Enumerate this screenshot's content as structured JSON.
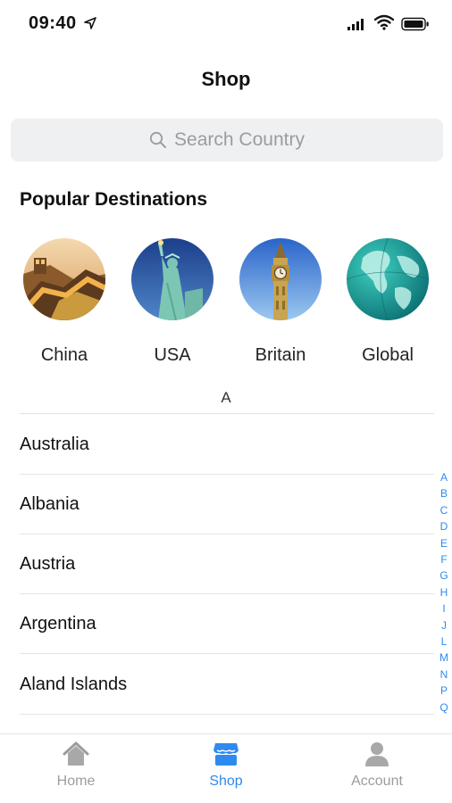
{
  "status_bar": {
    "time": "09:40"
  },
  "header": {
    "title": "Shop"
  },
  "search": {
    "placeholder": "Search Country"
  },
  "popular": {
    "title": "Popular Destinations",
    "items": [
      {
        "label": "China",
        "image": "great-wall"
      },
      {
        "label": "USA",
        "image": "statue-of-liberty"
      },
      {
        "label": "Britain",
        "image": "big-ben"
      },
      {
        "label": "Global",
        "image": "globe"
      }
    ]
  },
  "list": {
    "section_letter": "A",
    "countries": [
      "Australia",
      "Albania",
      "Austria",
      "Argentina",
      "Aland Islands"
    ]
  },
  "index_letters": [
    "A",
    "B",
    "C",
    "D",
    "E",
    "F",
    "G",
    "H",
    "I",
    "J",
    "L",
    "M",
    "N",
    "P",
    "Q"
  ],
  "tabs": [
    {
      "label": "Home",
      "icon": "home-icon",
      "active": false
    },
    {
      "label": "Shop",
      "icon": "shop-icon",
      "active": true
    },
    {
      "label": "Account",
      "icon": "account-icon",
      "active": false
    }
  ],
  "colors": {
    "accent": "#2f8af0",
    "inactive": "#9c9c9c",
    "search_bg": "#eff0f2"
  }
}
